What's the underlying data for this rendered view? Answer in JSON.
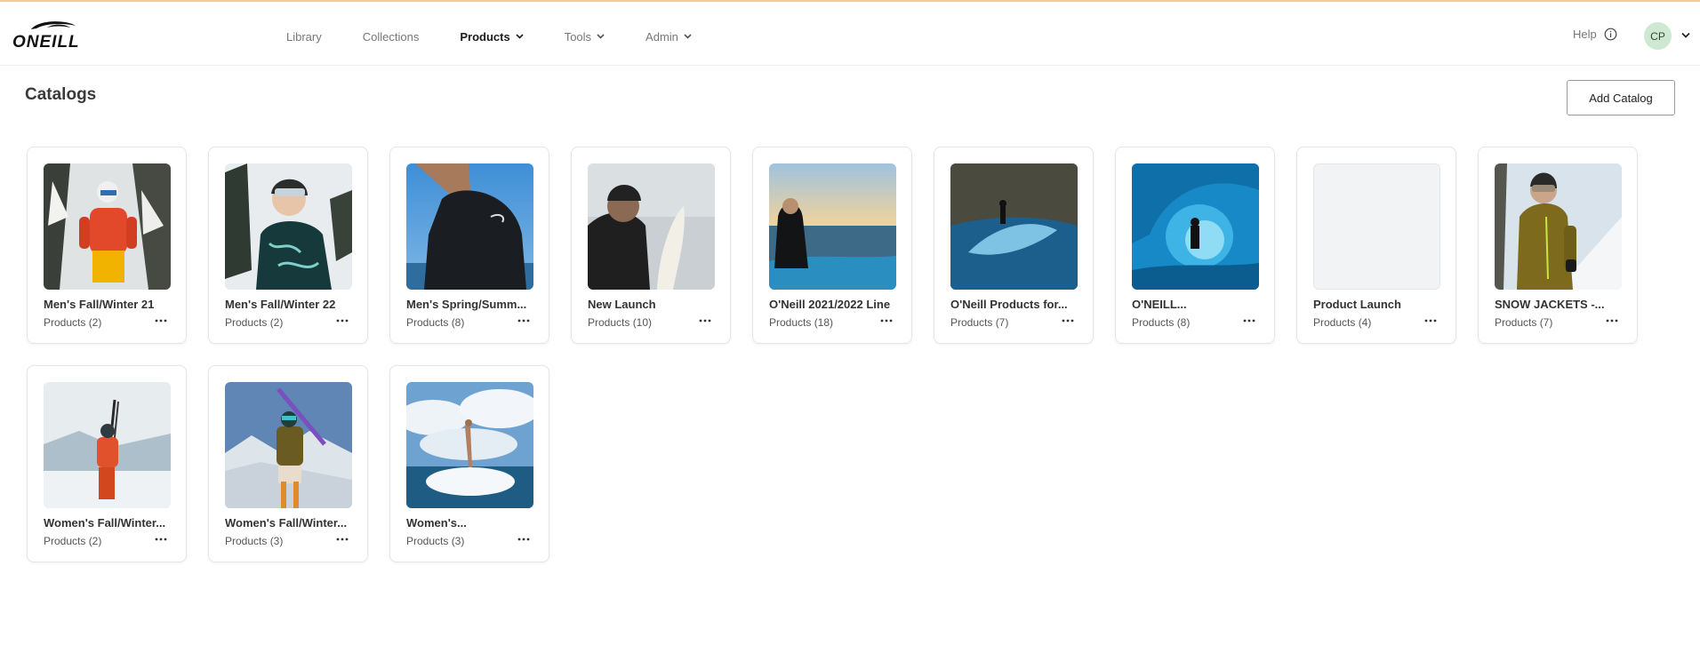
{
  "header": {
    "logo_text": "O'NEILL",
    "nav": [
      {
        "label": "Library",
        "dropdown": false,
        "active": false
      },
      {
        "label": "Collections",
        "dropdown": false,
        "active": false
      },
      {
        "label": "Products",
        "dropdown": true,
        "active": true
      },
      {
        "label": "Tools",
        "dropdown": true,
        "active": false
      },
      {
        "label": "Admin",
        "dropdown": true,
        "active": false
      }
    ],
    "help_label": "Help",
    "avatar_initials": "CP"
  },
  "page": {
    "title": "Catalogs",
    "add_button_label": "Add Catalog"
  },
  "catalogs": [
    {
      "title": "Men's Fall/Winter 21",
      "count": "Products (2)",
      "image": "skier-red-jacket-snowy-forest"
    },
    {
      "title": "Men's Fall/Winter 22",
      "count": "Products (2)",
      "image": "snowboarder-teal-jacket-trees"
    },
    {
      "title": "Men's Spring/Summ...",
      "count": "Products (8)",
      "image": "wetsuit-surfer-blue-sky"
    },
    {
      "title": "New Launch",
      "count": "Products (10)",
      "image": "surfer-beanie-surfboard"
    },
    {
      "title": "O'Neill 2021/2022 Line",
      "count": "Products (18)",
      "image": "woman-sitting-beach-sunset"
    },
    {
      "title": "O'Neill Products for...",
      "count": "Products (7)",
      "image": "surfer-wave-cliffs"
    },
    {
      "title": "O'NEILL...",
      "count": "Products (8)",
      "image": "surfer-barrel-wave"
    },
    {
      "title": "Product Launch",
      "count": "Products (4)",
      "image": "empty-placeholder"
    },
    {
      "title": "SNOW JACKETS -...",
      "count": "Products (7)",
      "image": "skier-olive-jacket-snow"
    },
    {
      "title": "Women's Fall/Winter...",
      "count": "Products (2)",
      "image": "woman-skier-orange-carrying-skis"
    },
    {
      "title": "Women's Fall/Winter...",
      "count": "Products (3)",
      "image": "woman-skier-olive-jacket-mountains"
    },
    {
      "title": "Women's...",
      "count": "Products (3)",
      "image": "surfer-splash-clouds"
    }
  ],
  "icons": {
    "chevron": "chevron-down-icon",
    "info": "info-icon",
    "more": "more-horizontal-icon"
  },
  "colors": {
    "top_accent": "#f2c9a0",
    "avatar_bg": "#cfe8d2",
    "card_border": "#e6e6e6"
  }
}
